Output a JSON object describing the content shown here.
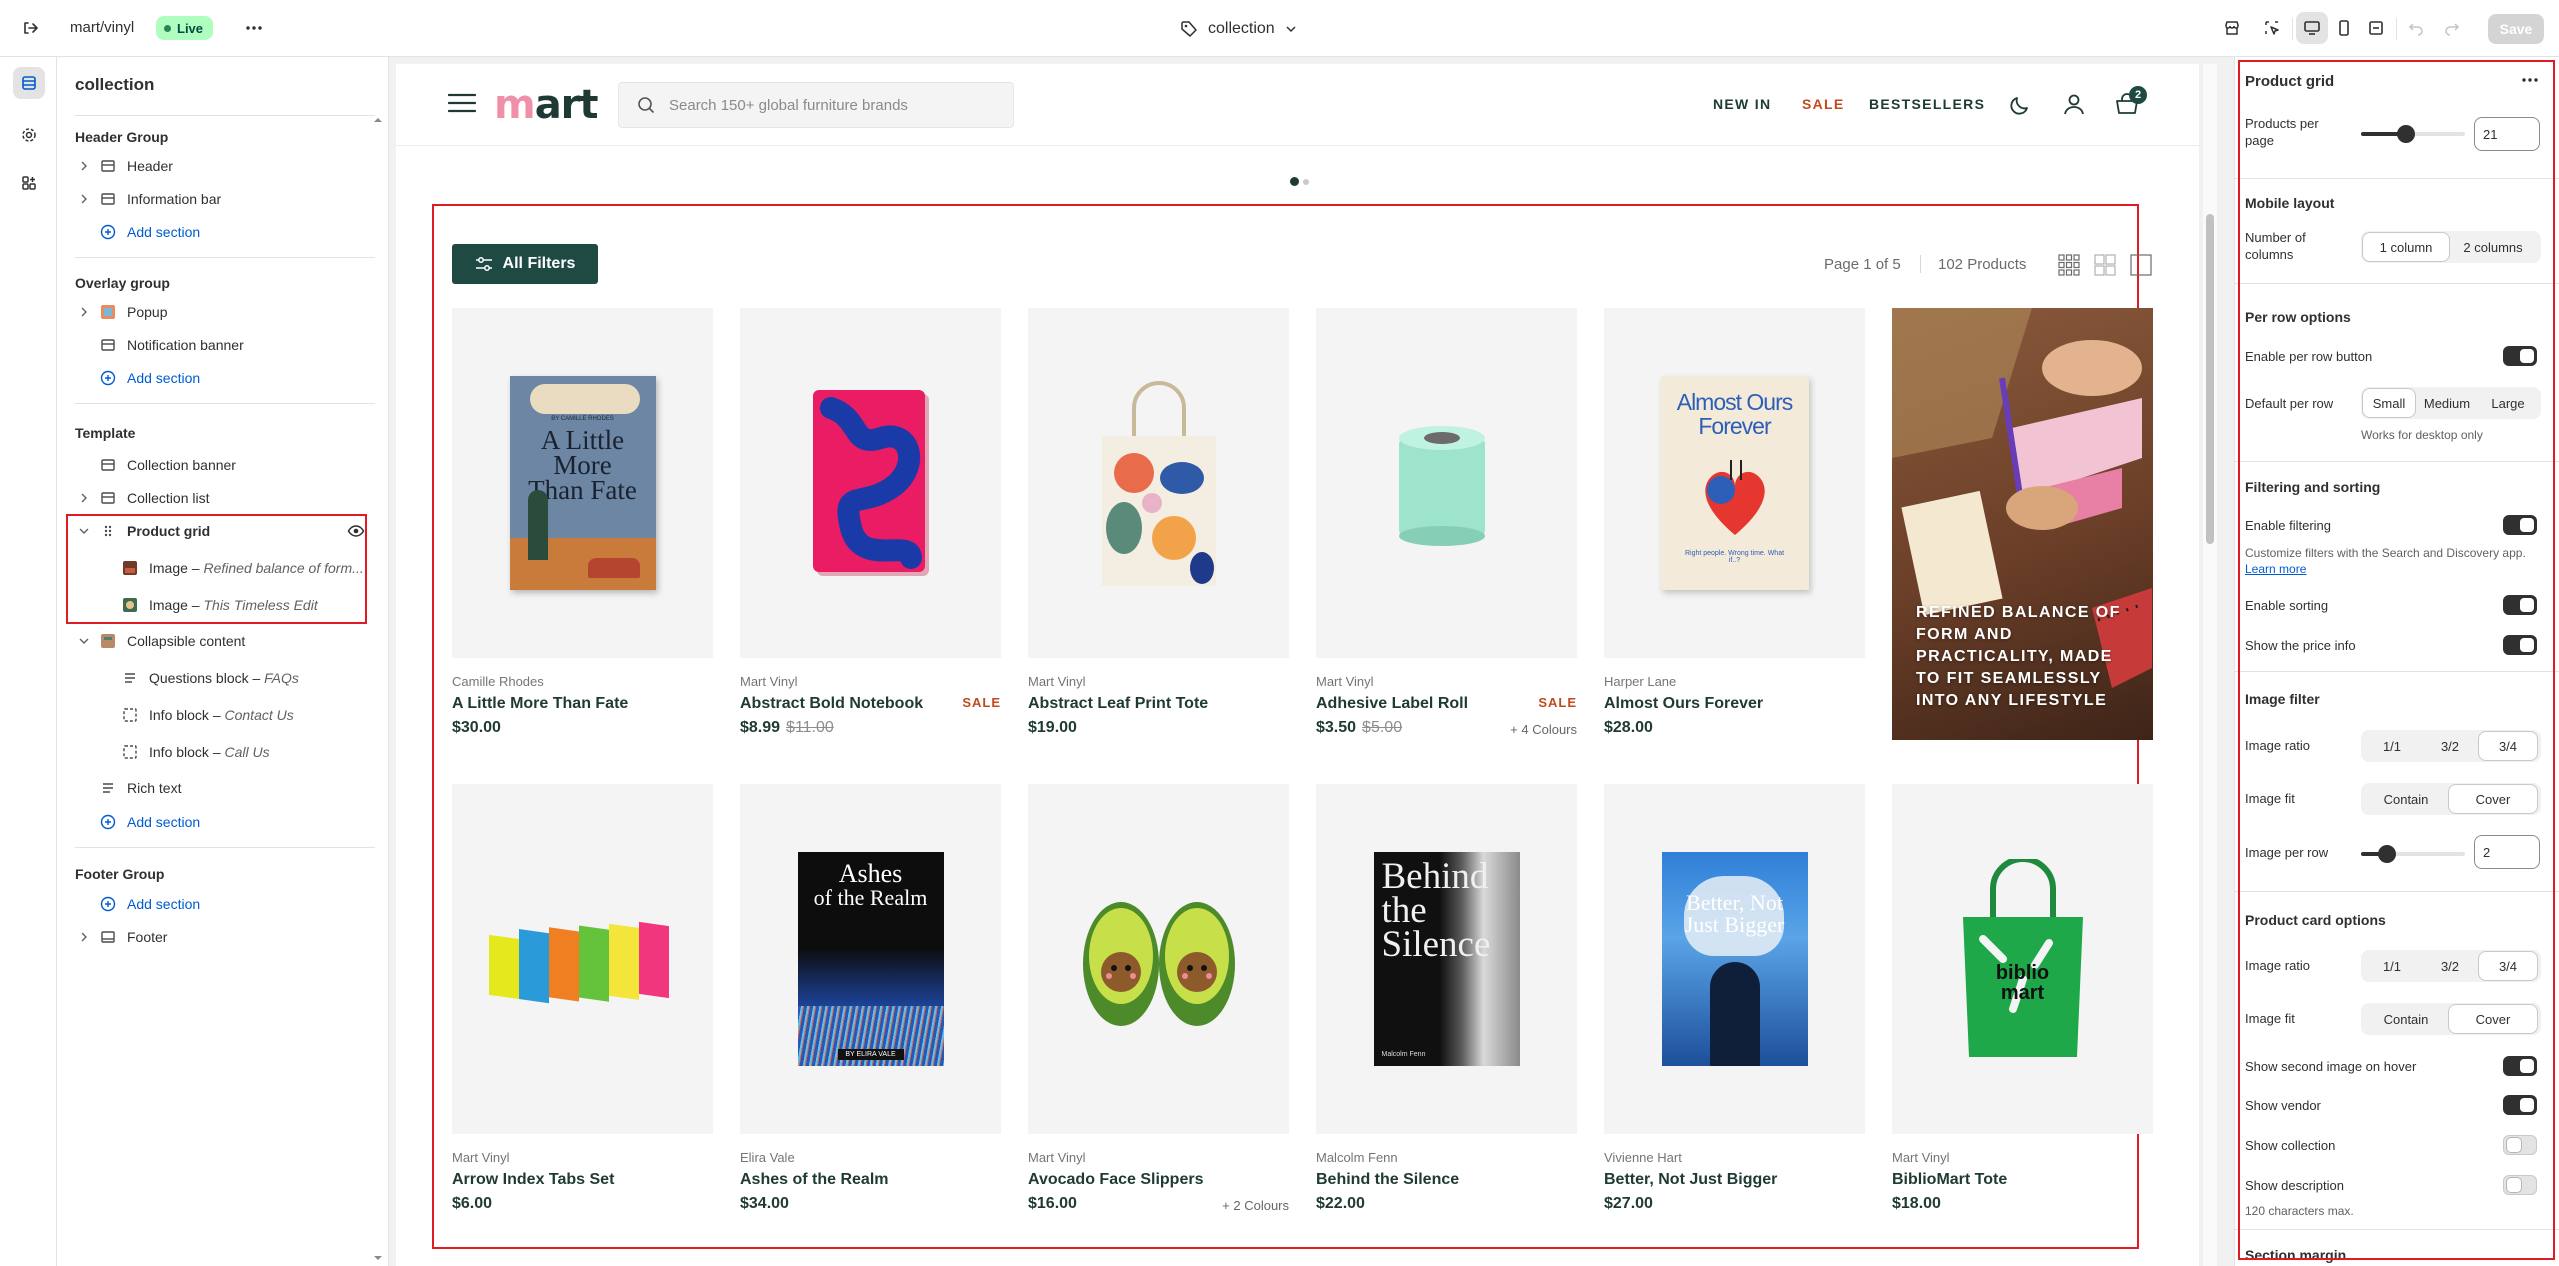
{
  "topbar": {
    "store": "mart/vinyl",
    "live": "Live",
    "template": "collection",
    "save": "Save"
  },
  "left": {
    "title": "collection",
    "groups": {
      "header": "Header Group",
      "overlay": "Overlay group",
      "template": "Template",
      "footer": "Footer Group"
    },
    "items": {
      "header": "Header",
      "infobar": "Information bar",
      "add1": "Add section",
      "popup": "Popup",
      "notif": "Notification banner",
      "add2": "Add section",
      "colbanner": "Collection banner",
      "collist": "Collection list",
      "pgrid": "Product grid",
      "img1a": "Image – ",
      "img1b": "Refined balance of form...",
      "img2a": "Image – ",
      "img2b": "This Timeless Edit",
      "collapsible": "Collapsible content",
      "q1a": "Questions block – ",
      "q1b": "FAQs",
      "i1a": "Info block – ",
      "i1b": "Contact Us",
      "i2a": "Info block – ",
      "i2b": "Call Us",
      "rich": "Rich text",
      "add3": "Add section",
      "add4": "Add section",
      "footer": "Footer"
    }
  },
  "store": {
    "logo": "mart",
    "search_placeholder": "Search 150+ global furniture brands",
    "nav": {
      "new": "NEW IN",
      "sale": "SALE",
      "best": "BESTSELLERS"
    },
    "cart_count": "2",
    "filters": "All Filters",
    "page": "Page 1 of 5",
    "count": "102 Products",
    "promo": "REFINED BALANCE OF FORM AND PRACTICALITY, MADE TO FIT SEAMLESSLY INTO ANY LIFESTYLE",
    "products": [
      {
        "vendor": "Camille Rhodes",
        "name": "A Little More Than Fate",
        "price": "$30.00",
        "compare": "",
        "tag": "",
        "colours": ""
      },
      {
        "vendor": "Mart Vinyl",
        "name": "Abstract Bold Notebook",
        "price": "$8.99",
        "compare": "$11.00",
        "tag": "SALE",
        "colours": ""
      },
      {
        "vendor": "Mart Vinyl",
        "name": "Abstract Leaf Print Tote",
        "price": "$19.00",
        "compare": "",
        "tag": "",
        "colours": ""
      },
      {
        "vendor": "Mart Vinyl",
        "name": "Adhesive Label Roll",
        "price": "$3.50",
        "compare": "$5.00",
        "tag": "SALE",
        "colours": "+ 4 Colours"
      },
      {
        "vendor": "Harper Lane",
        "name": "Almost Ours Forever",
        "price": "$28.00",
        "compare": "",
        "tag": "",
        "colours": ""
      },
      {
        "vendor": "Mart Vinyl",
        "name": "Arrow Index Tabs Set",
        "price": "$6.00",
        "compare": "",
        "tag": "",
        "colours": ""
      },
      {
        "vendor": "Elira Vale",
        "name": "Ashes of the Realm",
        "price": "$34.00",
        "compare": "",
        "tag": "",
        "colours": ""
      },
      {
        "vendor": "Mart Vinyl",
        "name": "Avocado Face Slippers",
        "price": "$16.00",
        "compare": "",
        "tag": "",
        "colours": "+ 2 Colours"
      },
      {
        "vendor": "Malcolm Fenn",
        "name": "Behind the Silence",
        "price": "$22.00",
        "compare": "",
        "tag": "",
        "colours": ""
      },
      {
        "vendor": "Vivienne Hart",
        "name": "Better, Not Just Bigger",
        "price": "$27.00",
        "compare": "",
        "tag": "",
        "colours": ""
      },
      {
        "vendor": "Mart Vinyl",
        "name": "BiblioMart Tote",
        "price": "$18.00",
        "compare": "",
        "tag": "",
        "colours": ""
      }
    ],
    "covers": {
      "b1": [
        "A Little",
        "More",
        "Than Fate"
      ],
      "b1by": "BY CAMILLE RHODES",
      "b5": [
        "Almost Ours",
        "Forever"
      ],
      "b5sub": "Right people. Wrong time. What if..?",
      "b7": [
        "Ashes",
        "of the Realm"
      ],
      "b7by": "BY ELIRA VALE",
      "b9": [
        "Behind",
        "the",
        "Silence"
      ],
      "b9by": "Malcolm Fenn",
      "b10": [
        "Better, Not",
        "Just Bigger"
      ],
      "tote": [
        "biblio",
        "mart"
      ]
    }
  },
  "settings": {
    "title": "Product grid",
    "per_page_label": "Products per page",
    "per_page": "21",
    "per_page_fraction": 0.43,
    "mobile_layout": "Mobile layout",
    "num_columns": "Number of columns",
    "col1": "1 column",
    "col2": "2 columns",
    "per_row_options": "Per row options",
    "enable_per_row": "Enable per row button",
    "default_per_row": "Default per row",
    "small": "Small",
    "medium": "Medium",
    "large": "Large",
    "desktop_only": "Works for desktop only",
    "filtering_sorting": "Filtering and sorting",
    "enable_filtering": "Enable filtering",
    "filter_note": "Customize filters with the Search and Discovery app.",
    "learn_more": "Learn more",
    "enable_sorting": "Enable sorting",
    "show_price": "Show the price info",
    "image_filter": "Image filter",
    "image_ratio": "Image ratio",
    "r1": "1/1",
    "r2": "3/2",
    "r3": "3/4",
    "image_fit": "Image fit",
    "contain": "Contain",
    "cover": "Cover",
    "image_per_row": "Image per row",
    "img_per_row": "2",
    "img_per_row_fraction": 0.25,
    "card_options": "Product card options",
    "image_ratio2": "Image ratio",
    "image_fit2": "Image fit",
    "second_img": "Show second image on hover",
    "show_vendor": "Show vendor",
    "show_collection": "Show collection",
    "show_description": "Show description",
    "desc_note": "120 characters max.",
    "section_margin": "Section margin"
  }
}
